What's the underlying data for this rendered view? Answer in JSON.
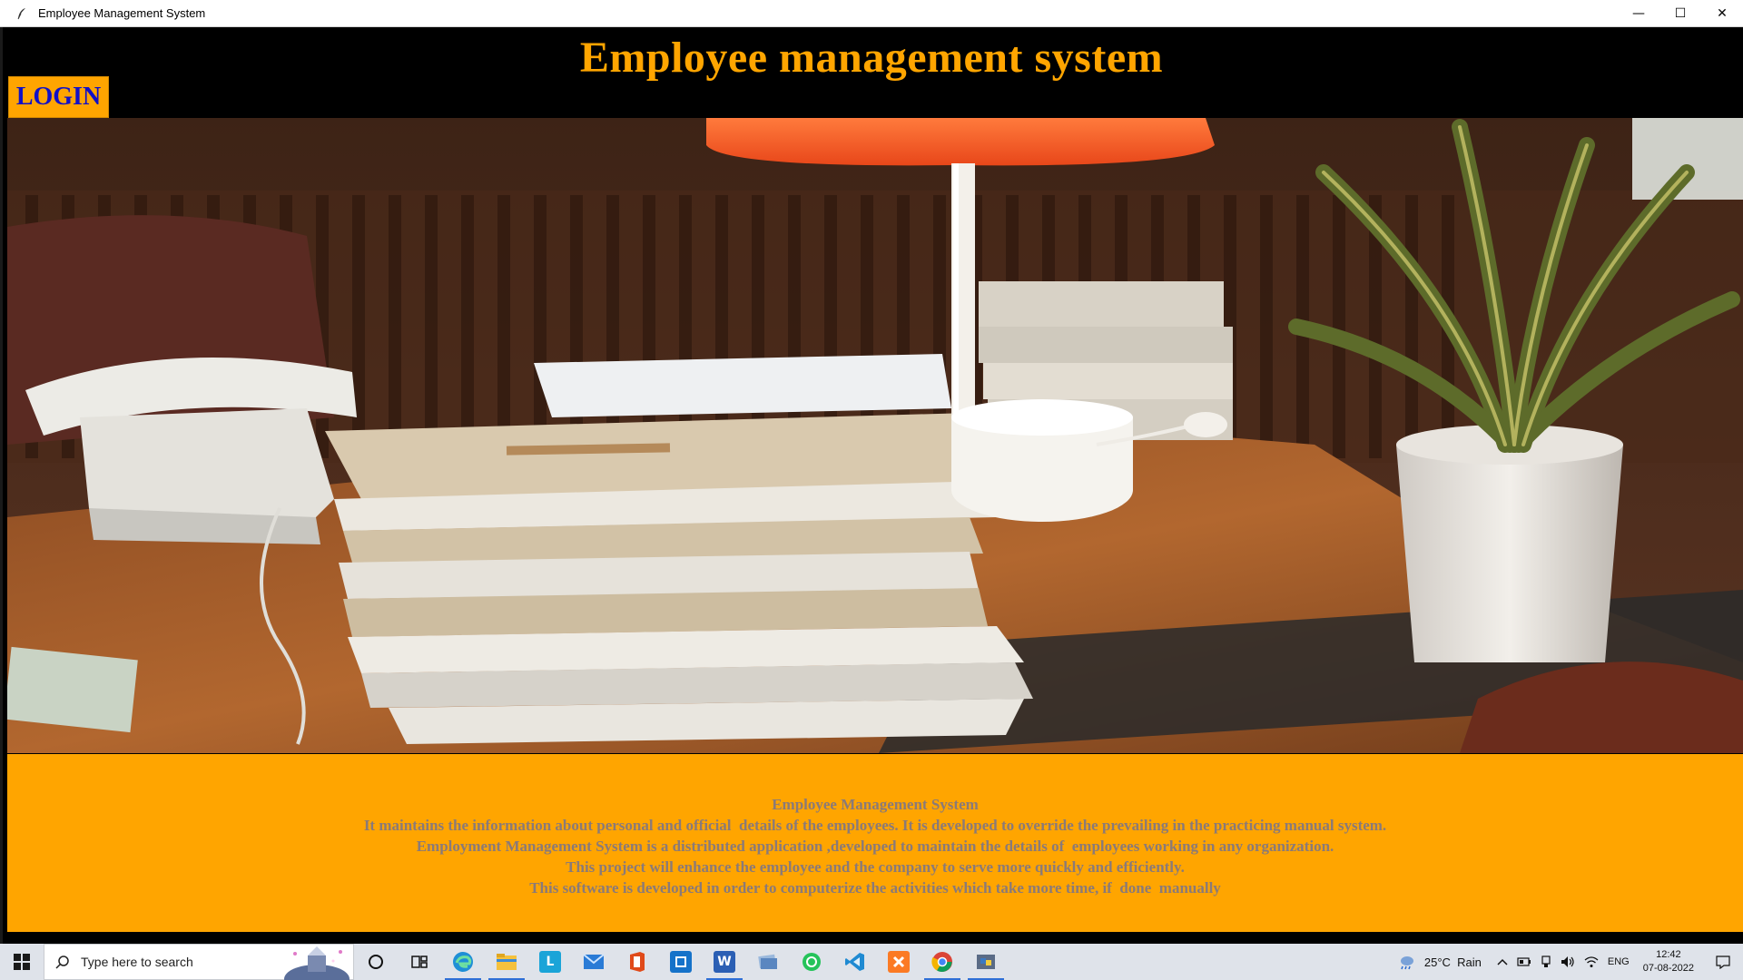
{
  "window": {
    "title": "Employee Management System",
    "controls": {
      "minimize": "—",
      "maximize": "☐",
      "close": "✕"
    }
  },
  "header": {
    "app_title": "Employee management system",
    "login_label": "LOGIN"
  },
  "photo": {
    "description_icon": "office-desk-photo"
  },
  "info": {
    "lines": [
      "Employee Management System",
      "It maintains the information about personal and official  details of the employees. It is developed to override the prevailing in the practicing manual system.",
      "Employment Management System is a distributed application ,developed to maintain the details of  employees working in any organization.",
      "This project will enhance the employee and the company to serve more quickly and efficiently.",
      "This software is developed in order to computerize the activities which take more time, if  done  manually"
    ]
  },
  "taskbar": {
    "search_placeholder": "Type here to search",
    "apps": [
      {
        "name": "cortana-icon"
      },
      {
        "name": "task-view-icon"
      },
      {
        "name": "edge-icon"
      },
      {
        "name": "file-explorer-icon"
      },
      {
        "name": "l-app-icon"
      },
      {
        "name": "mail-icon"
      },
      {
        "name": "office-icon"
      },
      {
        "name": "outlook-icon"
      },
      {
        "name": "word-icon"
      },
      {
        "name": "file-app-icon"
      },
      {
        "name": "whatsapp-icon"
      },
      {
        "name": "vscode-icon"
      },
      {
        "name": "xampp-icon"
      },
      {
        "name": "chrome-icon"
      },
      {
        "name": "python-icon"
      }
    ],
    "weather": "25°C  Rain",
    "language": "ENG",
    "time": "12:42",
    "date": "07-08-2022"
  },
  "colors": {
    "accent": "#ffa500",
    "login_text": "#1010c8",
    "info_text": "#8a7a78",
    "background": "#000000"
  }
}
